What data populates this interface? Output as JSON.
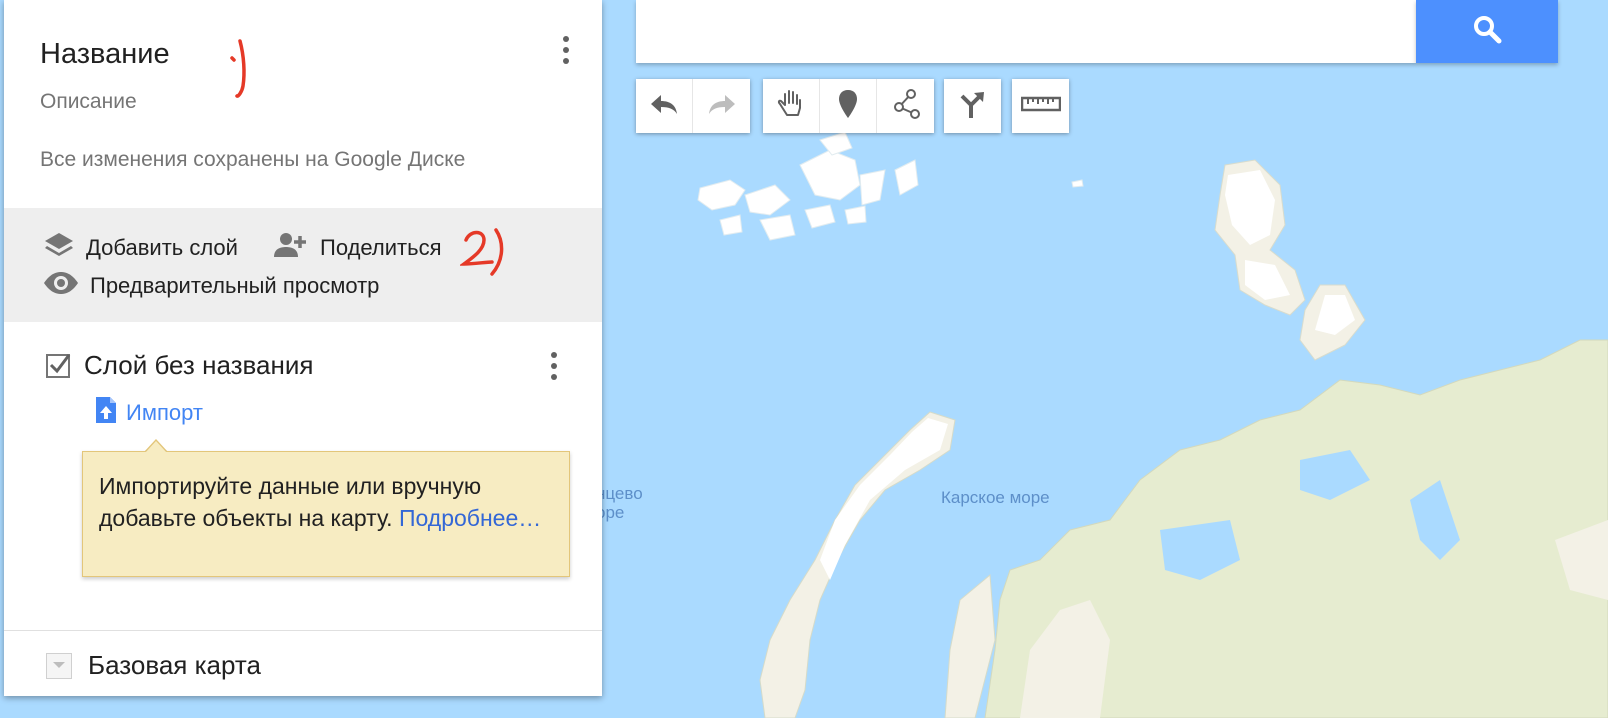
{
  "panel": {
    "title": "Название",
    "description": "Описание",
    "saved_status": "Все изменения сохранены на Google Диске",
    "actions": {
      "add_layer": "Добавить слой",
      "share": "Поделиться",
      "preview": "Предварительный просмотр"
    },
    "layer": {
      "name": "Слой без названия",
      "checked": true,
      "import_label": "Импорт"
    },
    "tip": {
      "text": "Импортируйте данные или вручную добавьте объекты на карту.",
      "link": "Подробнее…"
    },
    "base_map": "Базовая карта",
    "annotations": [
      "1)",
      "2)"
    ]
  },
  "search": {
    "value": "",
    "button_icon": "search-icon"
  },
  "toolbar": {
    "groups": [
      [
        "undo-icon",
        "redo-icon"
      ],
      [
        "hand-icon",
        "marker-icon",
        "line-icon"
      ],
      [
        "directions-icon"
      ],
      [
        "ruler-icon"
      ]
    ]
  },
  "map": {
    "sea_label": "Карское море",
    "clipped_label_line1": "нцево",
    "clipped_label_line2": "оре",
    "colors": {
      "water": "#aadaff",
      "land": "#f3f1e6",
      "land_green": "#e6ecd0",
      "ice": "#ffffff",
      "accent": "#4d90fe"
    }
  }
}
